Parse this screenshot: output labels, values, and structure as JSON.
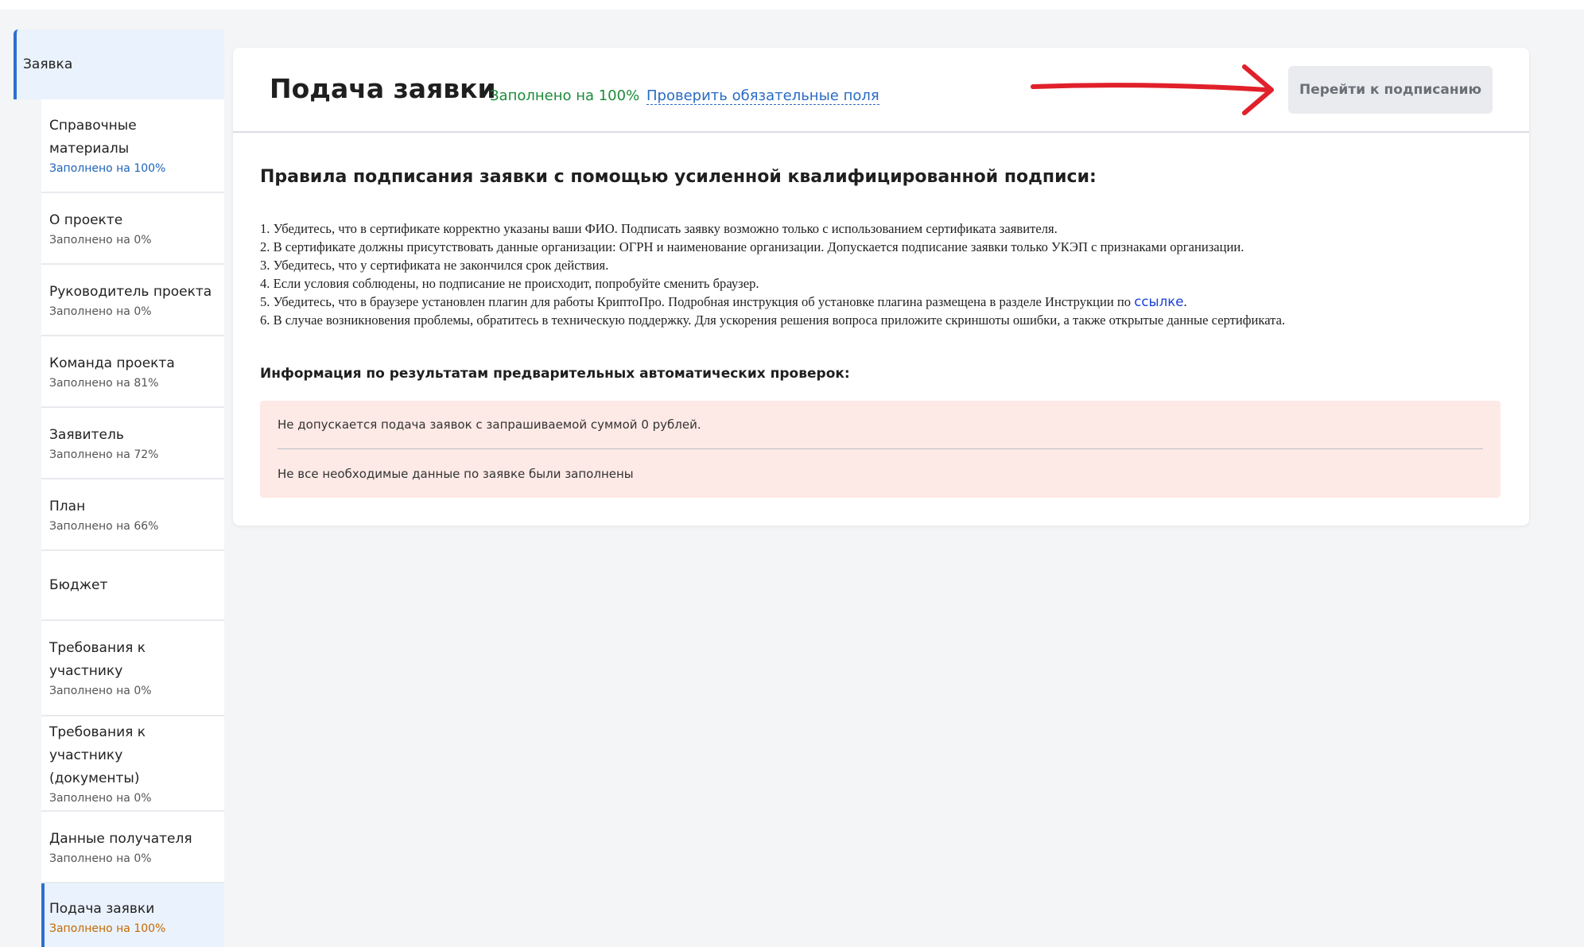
{
  "sidebar": {
    "header": "Заявка",
    "items": [
      {
        "label": "Справочные материалы",
        "status": "Заполнено на 100%"
      },
      {
        "label": "О проекте",
        "status": "Заполнено на 0%"
      },
      {
        "label": "Руководитель проекта",
        "status": "Заполнено на 0%"
      },
      {
        "label": "Команда проекта",
        "status": "Заполнено на 81%"
      },
      {
        "label": "Заявитель",
        "status": "Заполнено на 72%"
      },
      {
        "label": "План",
        "status": "Заполнено на 66%"
      },
      {
        "label": "Бюджет",
        "status": ""
      },
      {
        "label": "Требования к участнику",
        "status": "Заполнено на 0%"
      },
      {
        "label": "Требования к участнику (документы)",
        "status": "Заполнено на 0%"
      },
      {
        "label": "Данные получателя",
        "status": "Заполнено на 0%"
      },
      {
        "label": "Подача заявки",
        "status": "Заполнено на 100%"
      }
    ]
  },
  "main": {
    "title": "Подача заявки",
    "fill_status": "Заполнено на 100%",
    "check_link": "Проверить обязательные поля",
    "sign_button": "Перейти к подписанию",
    "rules_title": "Правила подписания заявки с помощью усиленной квалифицированной подписи:",
    "rules": [
      "1. Убедитесь, что в сертификате корректно указаны ваши ФИО. Подписать заявку возможно только с использованием сертификата заявителя.",
      "2. В сертификате должны присутствовать данные организации: ОГРН и наименование организации. Допускается подписание заявки только УКЭП с признаками организации.",
      "3. Убедитесь, что у сертификата не закончился срок действия.",
      "4. Если условия соблюдены, но подписание не происходит, попробуйте сменить браузер.",
      "5. Убедитесь, что в браузере установлен плагин для работы КриптоПро. Подробная инструкция об установке плагина размещена в разделе Инструкции по",
      "6. В случае возникновения проблемы, обратитесь в техническую поддержку.  Для ускорения решения вопроса приложите скриншоты ошибки, а также открытые данные сертификата."
    ],
    "rules_link": "ссылке",
    "info_title": "Информация по результатам предварительных автоматических проверок:",
    "alerts": [
      "Не допускается подача заявок с запрашиваемой суммой 0 рублей.",
      "Не все необходимые данные по заявке были заполнены"
    ],
    "arrow_color": "#e0202a"
  }
}
